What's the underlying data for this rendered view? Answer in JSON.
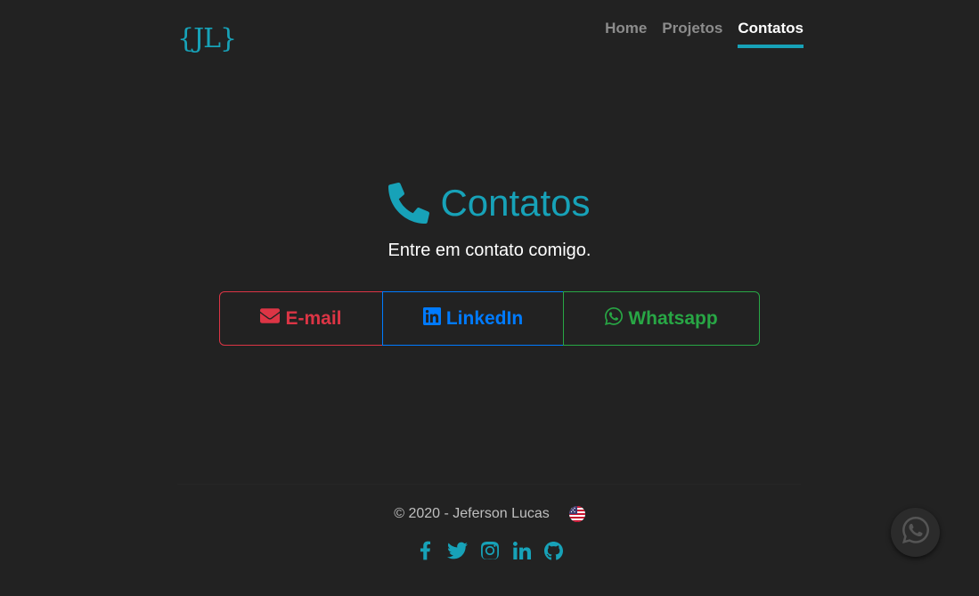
{
  "colors": {
    "background": "#222222",
    "accent": "#17a2b8",
    "email": "#dc3545",
    "linkedin": "#007bff",
    "whatsapp": "#28a745",
    "nav_inactive": "#8c8c8c",
    "nav_active": "#ffffff",
    "footer_text": "#bfbfbf"
  },
  "navbar": {
    "logo": "{JL}",
    "links": [
      {
        "label": "Home",
        "active": false
      },
      {
        "label": "Projetos",
        "active": false
      },
      {
        "label": "Contatos",
        "active": true
      }
    ]
  },
  "hero": {
    "icon": "phone-icon",
    "title": "Contatos",
    "subtitle": "Entre em contato comigo."
  },
  "contact_buttons": [
    {
      "label": "E-mail",
      "icon": "envelope-icon"
    },
    {
      "label": "LinkedIn",
      "icon": "linkedin-icon"
    },
    {
      "label": "Whatsapp",
      "icon": "whatsapp-icon"
    }
  ],
  "footer": {
    "copyright": "© 2020 - Jeferson Lucas",
    "language_icon": "us-flag-icon",
    "social_icons": [
      "facebook-icon",
      "twitter-icon",
      "instagram-icon",
      "linkedin-icon",
      "github-icon"
    ]
  },
  "floating_button": {
    "icon": "whatsapp-icon"
  }
}
